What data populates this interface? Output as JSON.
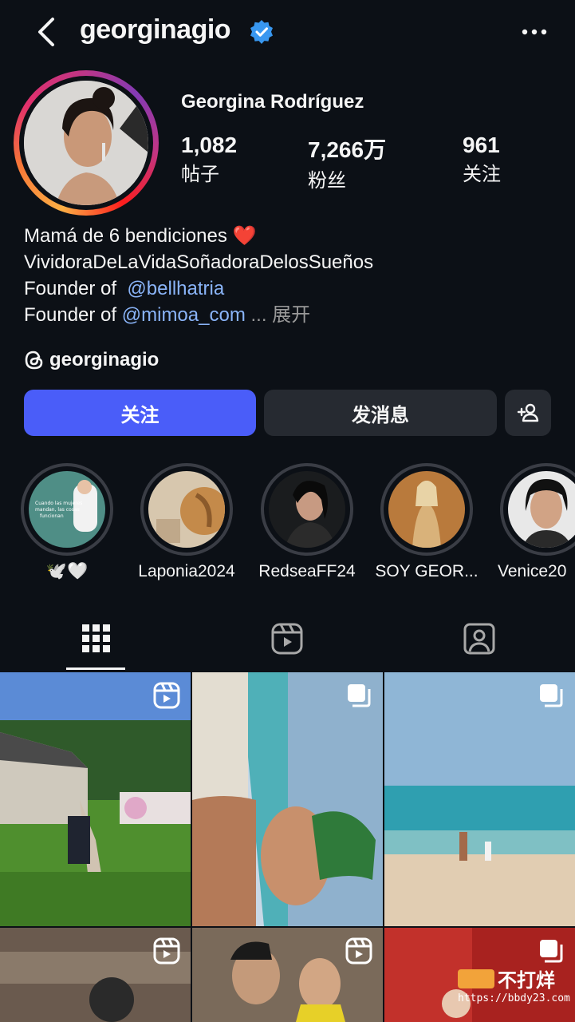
{
  "header": {
    "username": "georginagio",
    "back_icon": "chevron-left-icon",
    "verified_icon": "verified-badge-icon",
    "more_icon": "more-horizontal-icon"
  },
  "profile": {
    "full_name": "Georgina Rodríguez",
    "stats": [
      {
        "value": "1,082",
        "label": "帖子"
      },
      {
        "value": "7,266万",
        "label": "粉丝"
      },
      {
        "value": "961",
        "label": "关注"
      }
    ]
  },
  "bio": {
    "line1": "Mamá de 6 bendiciones ❤️",
    "line2": "VividoraDeLaVidaSoñadoraDelosSueños",
    "line3_prefix": "Founder of",
    "line3_mention": "@bellhatria",
    "line4_prefix": "Founder of",
    "line4_mention": "@mimoa_com",
    "ellipsis": "...",
    "expand": "展开"
  },
  "threads": {
    "handle": "georginagio",
    "icon": "threads-icon"
  },
  "actions": {
    "follow": "关注",
    "message": "发消息",
    "add_friend_icon": "add-person-icon"
  },
  "highlights": [
    {
      "label": "🕊️🤍",
      "cover_text": "Cuando las mujeres mandan, las cosas funcionan"
    },
    {
      "label": "Laponia2024"
    },
    {
      "label": "RedseaFF24"
    },
    {
      "label": "SOY GEOR..."
    },
    {
      "label": "Venice20"
    }
  ],
  "tabs": [
    {
      "name": "posts-grid-icon",
      "active": true
    },
    {
      "name": "reels-icon",
      "active": false
    },
    {
      "name": "tagged-icon",
      "active": false
    }
  ],
  "grid": [
    {
      "badge": "reel-icon"
    },
    {
      "badge": "carousel-icon"
    },
    {
      "badge": "carousel-icon"
    },
    {
      "badge": "reel-icon"
    },
    {
      "badge": "reel-icon"
    },
    {
      "badge": "carousel-icon"
    }
  ],
  "watermark": {
    "brand": "不打烊",
    "url": "https://bbdy23.com"
  },
  "colors": {
    "background": "#0c1016",
    "primary_button": "#4a5df9",
    "secondary_button": "#262a31",
    "mention": "#8ab4f8",
    "verified": "#3897f0"
  }
}
